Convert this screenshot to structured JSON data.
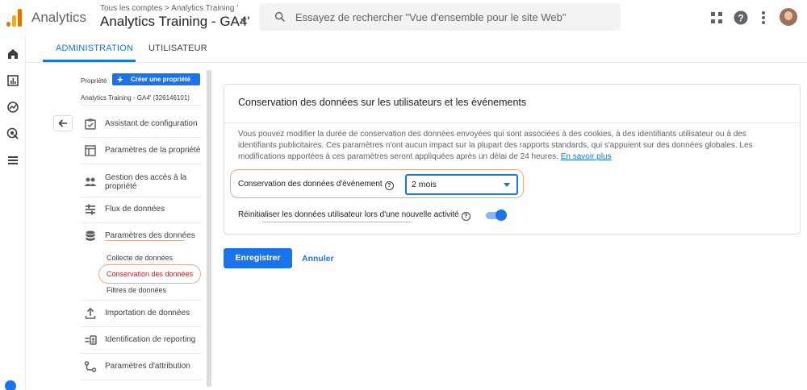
{
  "header": {
    "app_name": "Analytics",
    "breadcrumb": "Tous les comptes > Analytics Training '",
    "property_title": "Analytics Training - GA4'",
    "search_placeholder": "Essayez de rechercher \"Vue d'ensemble pour le site Web\"",
    "icons": [
      "apps-grid-icon",
      "help-icon",
      "more-vert-icon",
      "avatar"
    ]
  },
  "rail": {
    "icons": [
      "home-icon",
      "reports-icon",
      "explore-icon",
      "advertising-icon",
      "configure-icon"
    ]
  },
  "tabs": [
    {
      "label": "ADMINISTRATION",
      "active": true
    },
    {
      "label": "UTILISATEUR",
      "active": false
    }
  ],
  "nav": {
    "property_label": "Propriété",
    "create_button": "Créer une propriété",
    "property_id": "Analytics Training - GA4' (326146101)",
    "items": [
      {
        "label": "Assistant de configuration",
        "icon": "checklist-icon"
      },
      {
        "label": "Paramètres de la propriété",
        "icon": "layout-icon"
      },
      {
        "label": "Gestion des accès à la propriété",
        "icon": "people-icon"
      },
      {
        "label": "Flux de données",
        "icon": "streams-icon"
      },
      {
        "label": "Paramètres des données",
        "icon": "database-icon"
      },
      {
        "label": "Importation de données",
        "icon": "upload-icon"
      },
      {
        "label": "Identification de reporting",
        "icon": "identity-icon"
      },
      {
        "label": "Paramètres d'attribution",
        "icon": "attribution-icon"
      }
    ],
    "sub_items": [
      {
        "label": "Collecte de données",
        "active": false
      },
      {
        "label": "Conservation des données",
        "active": true
      },
      {
        "label": "Filtres de données",
        "active": false
      }
    ]
  },
  "card": {
    "title": "Conservation des données sur les utilisateurs et les événements",
    "description": "Vous pouvez modifier la durée de conservation des données envoyées qui sont associées à des cookies, à des identifiants utilisateur ou à des identifiants publicitaires. Ces paramètres n'ont aucun impact sur la plupart des rapports standards, qui s'appuient sur des données globales. Les modifications apportées à ces paramètres seront appliquées après un délai de 24 heures.",
    "learn_more": "En savoir plus",
    "retention_label": "Conservation des données d'événement",
    "retention_value": "2 mois",
    "reset_label": "Réinitialiser les données utilisateur lors d'une nouvelle activité",
    "reset_enabled": true
  },
  "actions": {
    "save": "Enregistrer",
    "cancel": "Annuler"
  },
  "colors": {
    "accent": "#1a73e8",
    "highlight": "#e8a98f",
    "active_sub": "#c5221f"
  }
}
